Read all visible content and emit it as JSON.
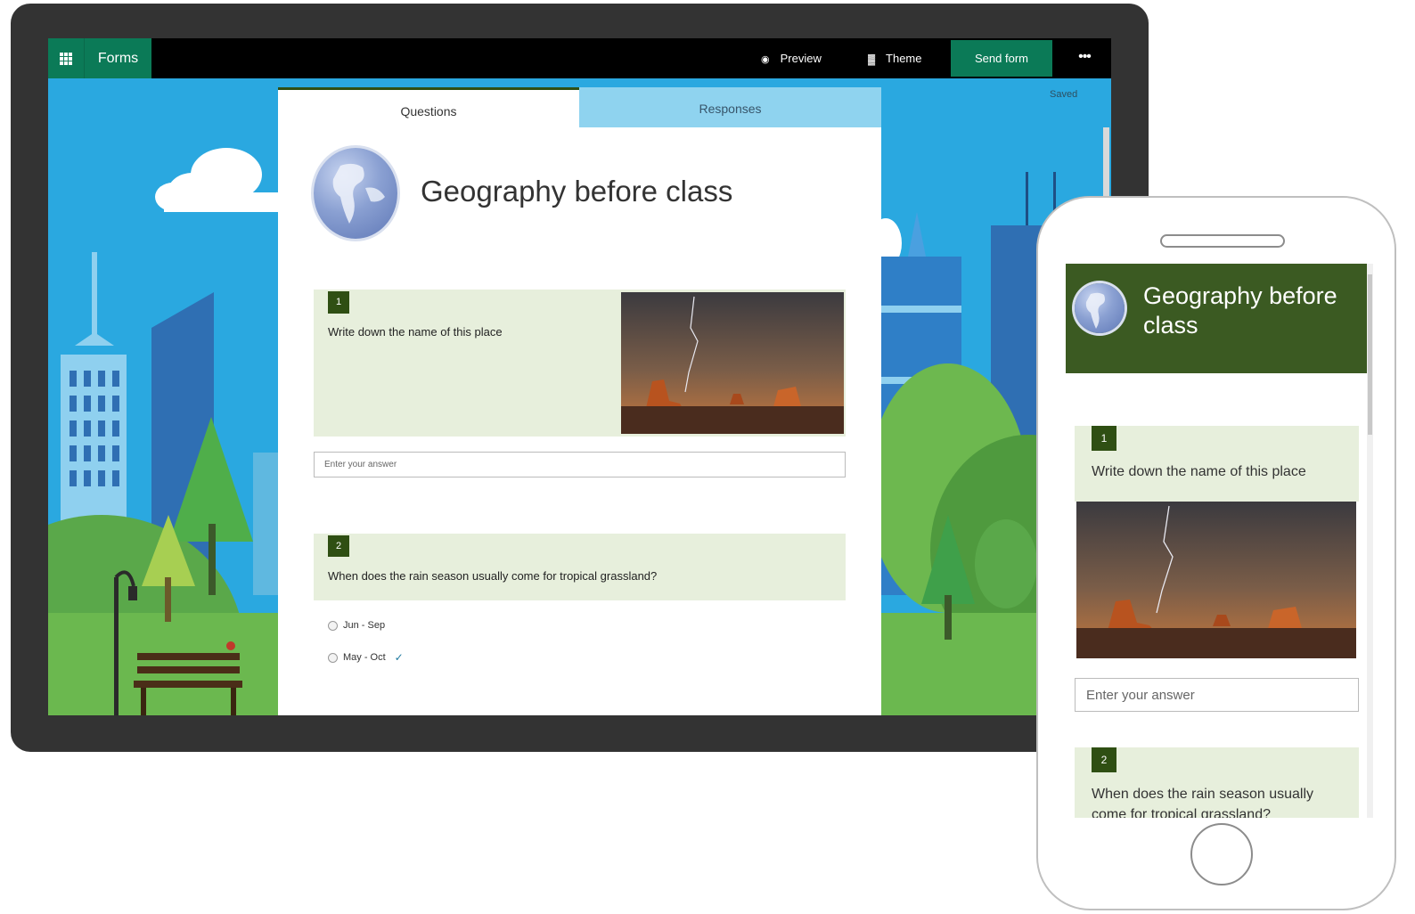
{
  "tablet": {
    "topbar": {
      "app_name": "Forms",
      "preview_label": "Preview",
      "theme_label": "Theme",
      "send_label": "Send form",
      "more_label": "•••"
    },
    "saved_status": "Saved",
    "tabs": {
      "questions": "Questions",
      "responses": "Responses"
    },
    "form": {
      "title": "Geography before class",
      "questions": [
        {
          "number": "1",
          "text": "Write down the name of this place",
          "answer_placeholder": "Enter your answer"
        },
        {
          "number": "2",
          "text": "When does the rain season usually come for tropical grassland?",
          "options": [
            "Jun - Sep",
            "May - Oct"
          ],
          "selected_mark": "✓"
        }
      ]
    }
  },
  "phone": {
    "form": {
      "title": "Geography before class",
      "questions": [
        {
          "number": "1",
          "text": "Write down the name of this place",
          "answer_placeholder": "Enter your answer"
        },
        {
          "number": "2",
          "text": "When does the rain season usually come for tropical grassland?"
        }
      ]
    }
  },
  "colors": {
    "accent_green": "#0b7a57",
    "header_green": "#3b5a22",
    "question_bg": "#e7efdc",
    "sky_blue": "#2aa8e0",
    "tab_responses": "#8fd3ef"
  },
  "icons": [
    "waffle-icon",
    "eye-icon",
    "paint-brush-icon",
    "more-icon",
    "globe-icon",
    "checkmark-icon"
  ]
}
